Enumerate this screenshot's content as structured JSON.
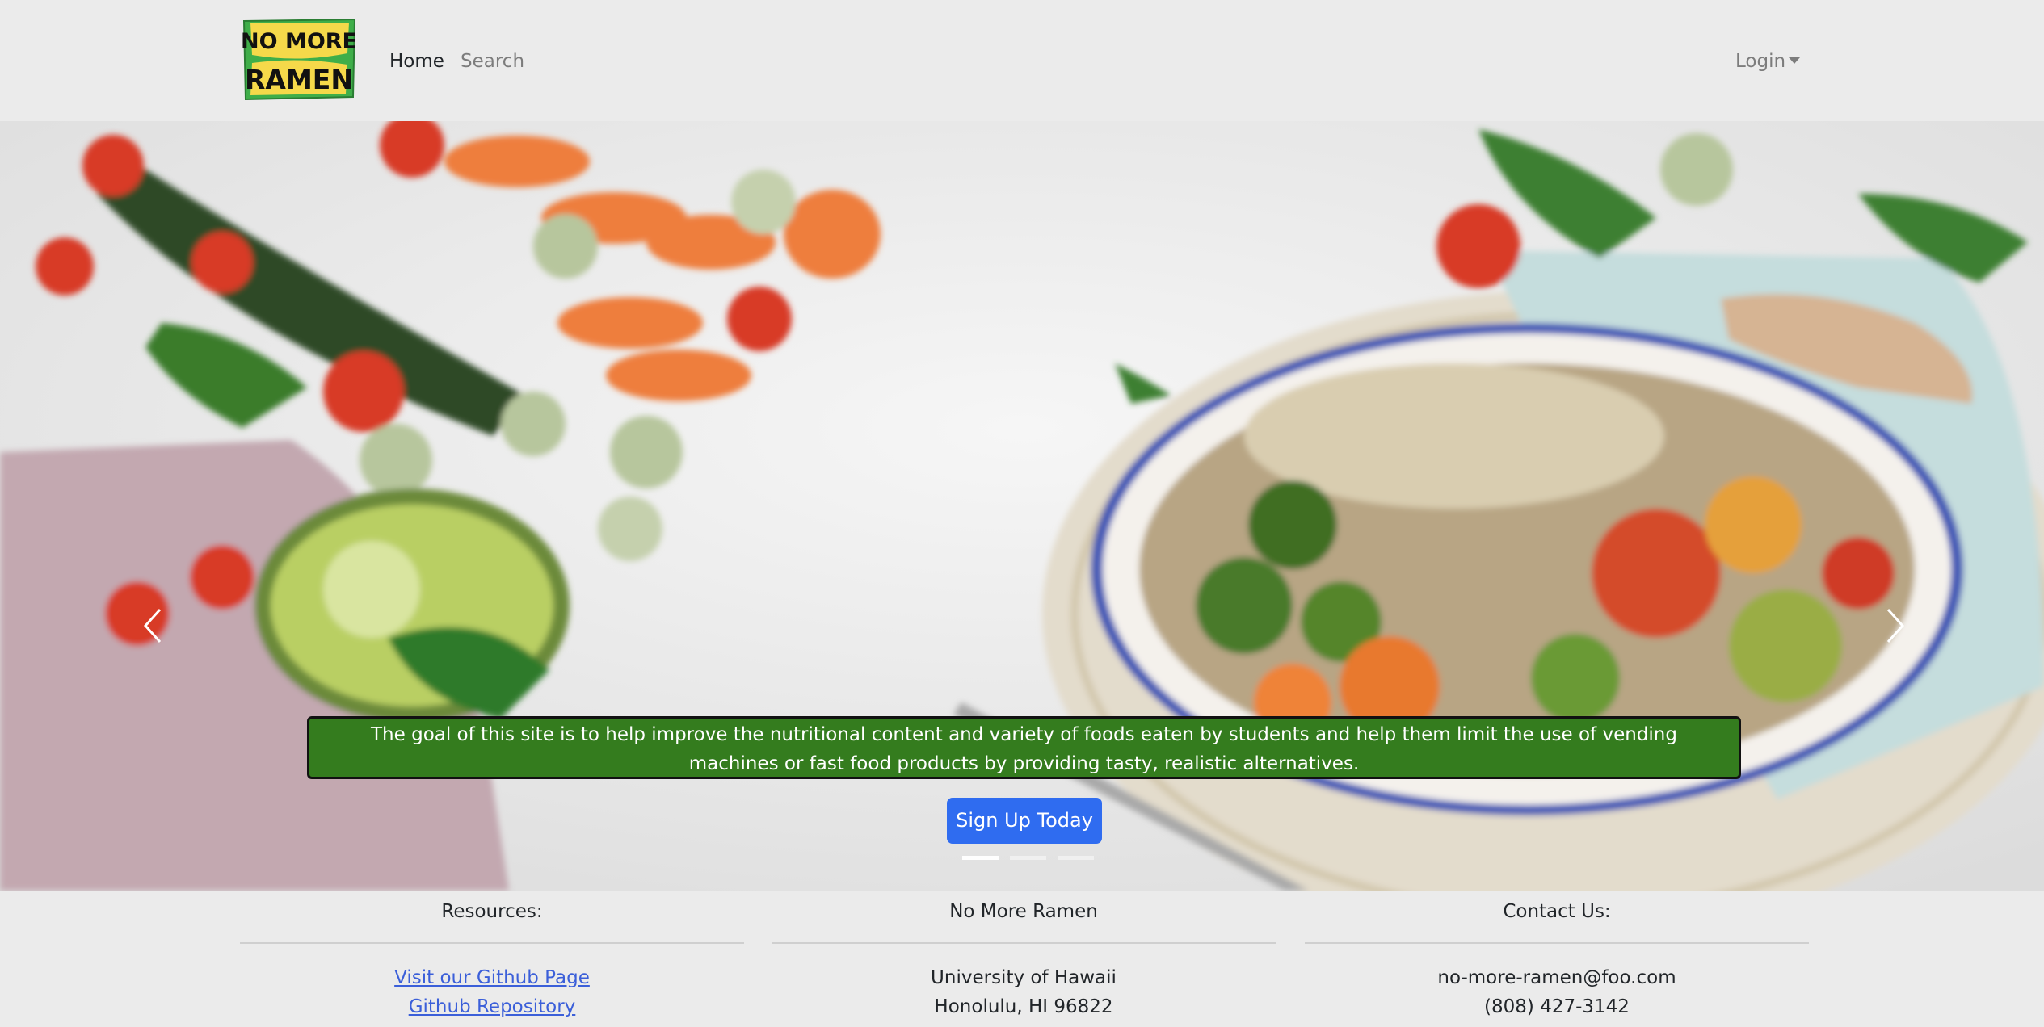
{
  "navbar": {
    "logo_text_line1": "NO MORE",
    "logo_text_line2": "RAMEN",
    "home_label": "Home",
    "search_label": "Search",
    "login_label": "Login"
  },
  "hero": {
    "caption": "The goal of this site is to help improve the nutritional content and variety of foods eaten by students and help them limit the use of vending machines or fast food products by providing tasty, realistic alternatives.",
    "signup_label": "Sign Up Today",
    "slides_count": 3,
    "active_slide": 1
  },
  "footer": {
    "resources": {
      "heading": "Resources:",
      "links": [
        "Visit our Github Page",
        "Github Repository"
      ]
    },
    "about": {
      "heading": "No More Ramen",
      "lines": [
        "University of Hawaii",
        "Honolulu, HI 96822"
      ]
    },
    "contact": {
      "heading": "Contact Us:",
      "lines": [
        "no-more-ramen@foo.com",
        "(808) 427-3142"
      ]
    }
  },
  "colors": {
    "caption_bg": "#347c1e",
    "button_bg": "#2f6cf0",
    "logo_green": "#3fae49",
    "logo_yellow": "#f5d94a",
    "link": "#3b5fd9"
  },
  "icons": [
    "chevron-left-icon",
    "chevron-right-icon",
    "caret-down-icon"
  ]
}
